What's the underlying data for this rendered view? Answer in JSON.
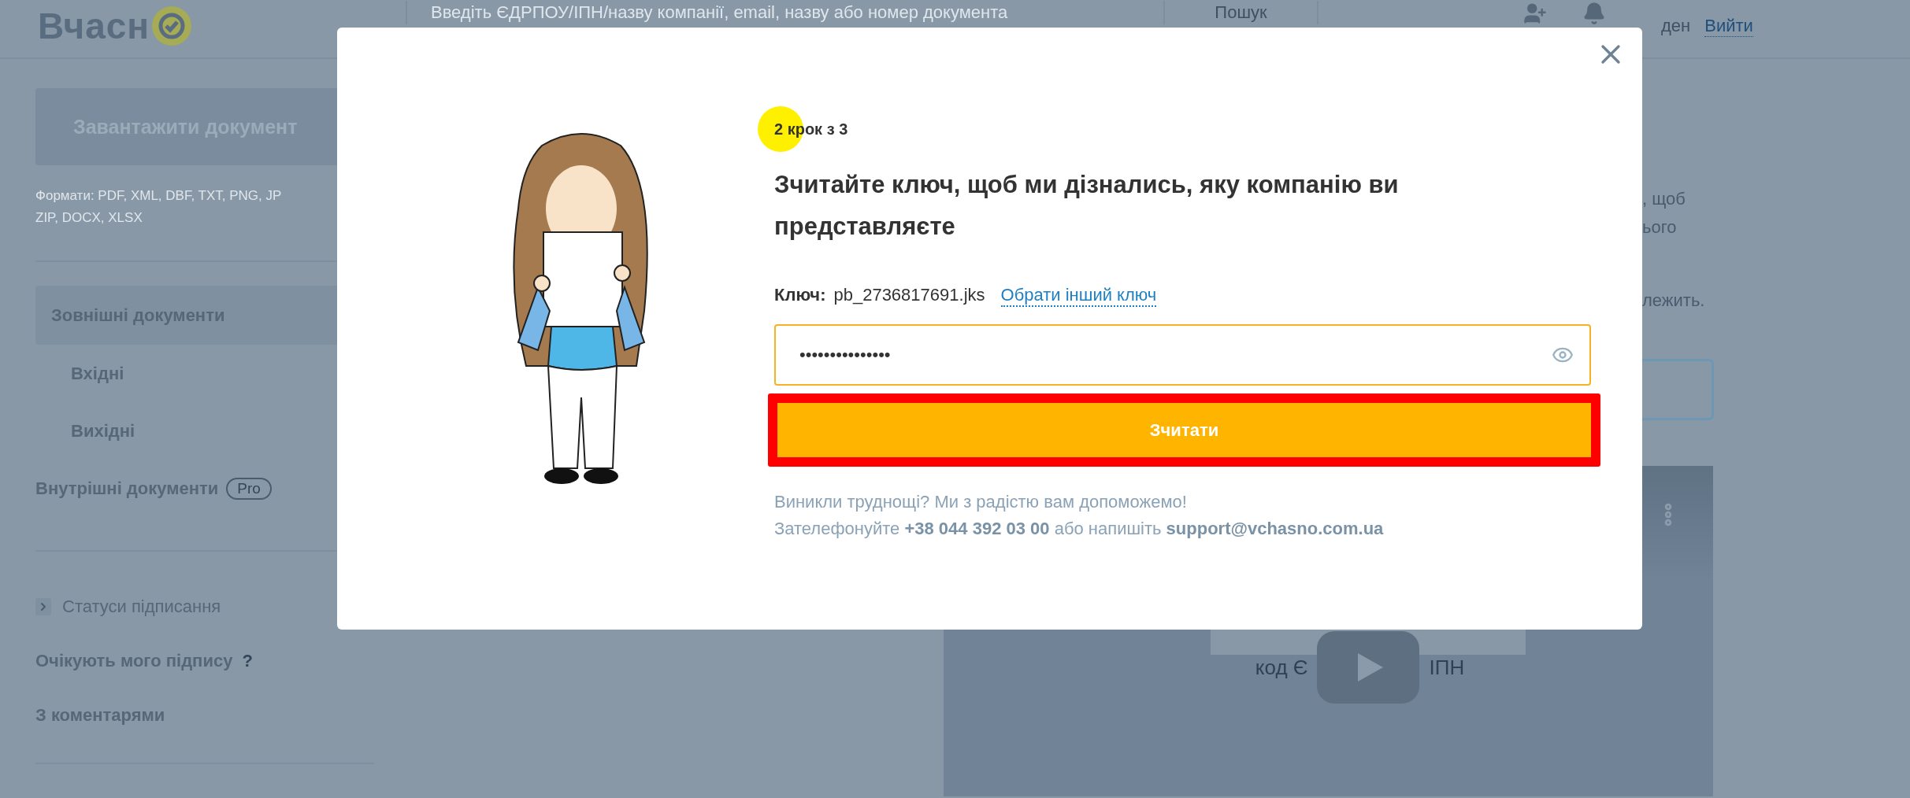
{
  "header": {
    "logo_text": "Вчасн",
    "search": {
      "placeholder": "Введіть ЄДРПОУ/ІПН/назву компанії, email, назву або номер документа"
    },
    "search_button": "Пошук",
    "user_name": "ден",
    "logout_link": "Вийти"
  },
  "sidebar": {
    "upload_button": "Завантажити документ",
    "formats": [
      "Формати: PDF, XML, DBF, TXT, PNG, JP",
      "ZIP, DOCX, XLSX"
    ],
    "nav": [
      {
        "label": "Зовнішні документи",
        "selected": true,
        "children": [
          {
            "label": "Вхідні",
            "selected": false
          },
          {
            "label": "Вихідні",
            "selected": false
          }
        ]
      },
      {
        "label": "Внутрішні документи",
        "selected": false,
        "badge": "Pro"
      }
    ],
    "filters": [
      {
        "kind": "expander",
        "label": "Статуси підписання",
        "expanded": false
      },
      {
        "kind": "help",
        "label": "Очікують мого підпису",
        "help": "?"
      },
      {
        "kind": "plain",
        "label": "З коментарями"
      }
    ]
  },
  "main": {
    "text_fragments": [
      ", щоб",
      "ього",
      "лежить."
    ],
    "video": {
      "caption_parts": [
        "код Є",
        "ІПН"
      ]
    }
  },
  "modal": {
    "step": "2 крок з 3",
    "heading": "Зчитайте ключ, щоб ми дізнались, яку компанію ви представляєте",
    "key_label": "Ключ:",
    "key_file": "pb_2736817691.jks",
    "change_key_link": "Обрати інший ключ",
    "password": {
      "value": "•••••••••••••••"
    },
    "submit_button": "Зчитати",
    "help_lines": [
      "Виникли труднощі? Ми з радістю вам допоможемо!",
      "Зателефонуйте **+38 044 392 03 00** або напишіть **support@vchasno.com.ua**"
    ]
  }
}
